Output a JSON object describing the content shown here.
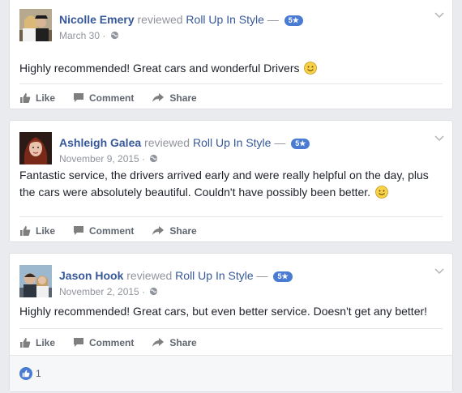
{
  "actions": {
    "like": "Like",
    "comment": "Comment",
    "share": "Share"
  },
  "reviews": [
    {
      "author": "Nicolle Emery",
      "verb": "reviewed",
      "page": "Roll Up In Style",
      "dash": "—",
      "rating": "5★",
      "date": "March 30",
      "dot": "·",
      "text": "Highly recommended! Great cars and wonderful Drivers"
    },
    {
      "author": "Ashleigh Galea",
      "verb": "reviewed",
      "page": "Roll Up In Style",
      "dash": "—",
      "rating": "5★",
      "date": "November 9, 2015",
      "dot": "·",
      "text": "Fantastic service, the drivers arrived early and were really helpful on the day, plus the cars were absolutely beautiful. Couldn't have possibly been better."
    },
    {
      "author": "Jason Hook",
      "verb": "reviewed",
      "page": "Roll Up In Style",
      "dash": "—",
      "rating": "5★",
      "date": "November 2, 2015",
      "dot": "·",
      "text": "Highly recommended! Great cars, but even better service. Doesn't get any better!",
      "like_count": "1"
    }
  ],
  "colors": {
    "link": "#365899",
    "muted": "#90949c",
    "badge": "#4a7bd3",
    "background": "#e9ebee"
  }
}
